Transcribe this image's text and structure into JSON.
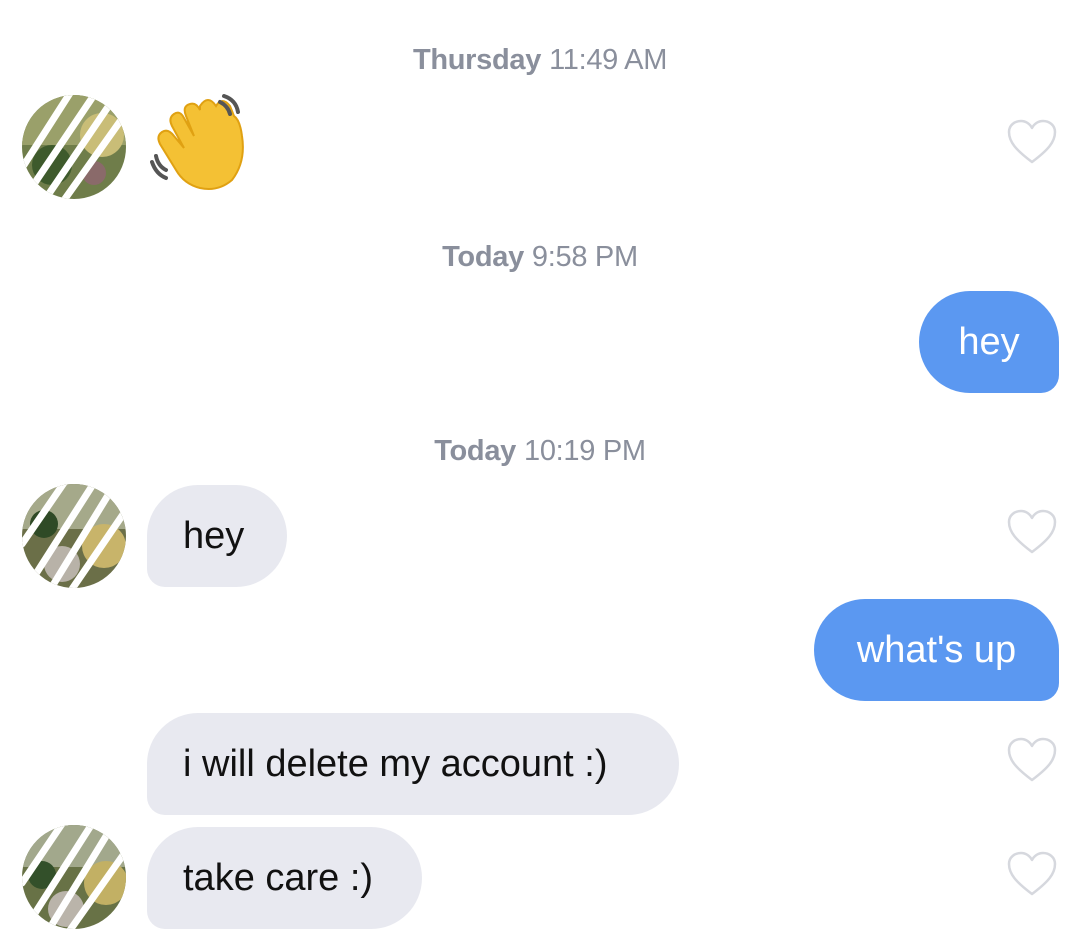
{
  "conversation": {
    "timestamps": [
      {
        "day": "Thursday",
        "time": "11:49 AM"
      },
      {
        "day": "Today",
        "time": "9:58 PM"
      },
      {
        "day": "Today",
        "time": "10:19 PM"
      }
    ],
    "messages": [
      {
        "sender": "them",
        "type": "emoji",
        "icon": "waving-hand-emoji",
        "text": "👋"
      },
      {
        "sender": "me",
        "type": "text",
        "text": "hey"
      },
      {
        "sender": "them",
        "type": "text",
        "text": "hey"
      },
      {
        "sender": "me",
        "type": "text",
        "text": "what's up"
      },
      {
        "sender": "them",
        "type": "text",
        "text": "i will delete my account :)"
      },
      {
        "sender": "them",
        "type": "text",
        "text": "take care :)"
      }
    ]
  },
  "colors": {
    "outgoing_bubble": "#5b98f1",
    "incoming_bubble": "#e8e9f0",
    "timestamp_text": "#8a8f9c",
    "heart_outline": "#d6d8de"
  }
}
